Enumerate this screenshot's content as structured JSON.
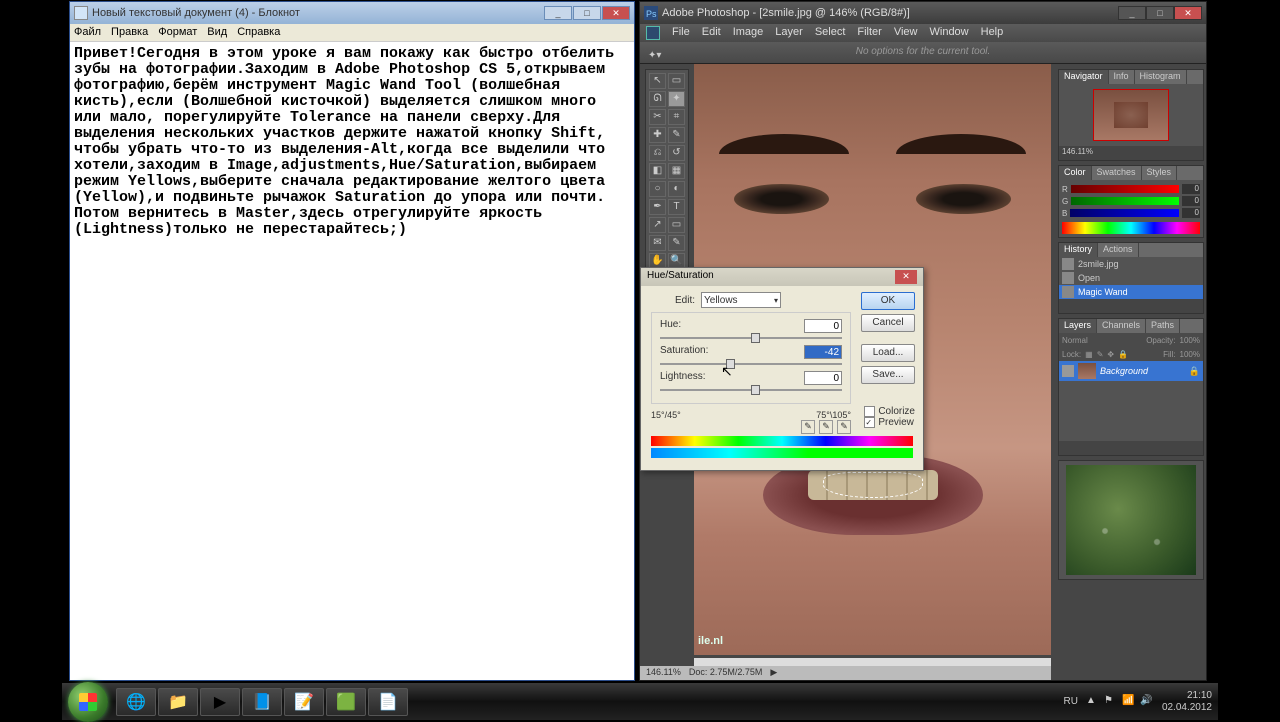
{
  "notepad": {
    "title": "Новый текстовый документ (4) - Блокнот",
    "menu": [
      "Файл",
      "Правка",
      "Формат",
      "Вид",
      "Справка"
    ],
    "content": "Привет!Сегодня в этом уроке я вам покажу как быстро отбелить зубы на фотографии.Заходим в Adobe Photoshop CS 5,открываем фотографию,берём инструмент Magic Wand Tool (волшебная кисть),если (Волшебной кисточкой) выделяется слишком много или мало, порегулируйте Tolerance на панели сверху.Для выделения нескольких участков держите нажатой кнопку Shift, чтобы убрать что-то из выделения-Alt,когда все выделили что хотели,заходим в Image,adjustments,Hue/Saturation,выбираем режим Yellows,выберите сначала редактирование желтого цвета (Yellow),и подвиньте рычажок Saturation до упора или почти. Потом вернитесь в Master,здесь отрегулируйте яркость (Lightness)только не перестарайтесь;)"
  },
  "photoshop": {
    "title": "Adobe Photoshop - [2smile.jpg @ 146% (RGB/8#)]",
    "menu": [
      "File",
      "Edit",
      "Image",
      "Layer",
      "Select",
      "Filter",
      "View",
      "Window",
      "Help"
    ],
    "options_text": "No options for the current tool.",
    "watermark": "ile.nl",
    "status": {
      "zoom": "146.11%",
      "doc": "Doc: 2.75M/2.75M"
    },
    "navigator": {
      "tabs": [
        "Navigator",
        "Info",
        "Histogram"
      ],
      "zoom": "146.11%"
    },
    "color": {
      "tabs": [
        "Color",
        "Swatches",
        "Styles"
      ],
      "r": "0",
      "g": "0",
      "b": "0"
    },
    "history": {
      "tabs": [
        "History",
        "Actions"
      ],
      "file": "2smile.jpg",
      "items": [
        "Open",
        "Magic Wand"
      ]
    },
    "layers": {
      "tabs": [
        "Layers",
        "Channels",
        "Paths"
      ],
      "mode": "Normal",
      "opacity_label": "Opacity:",
      "opacity": "100%",
      "lock": "Lock:",
      "fill_label": "Fill:",
      "fill": "100%",
      "layer": "Background"
    }
  },
  "hs": {
    "title": "Hue/Saturation",
    "edit_label": "Edit:",
    "edit_value": "Yellows",
    "hue_label": "Hue:",
    "hue_value": "0",
    "sat_label": "Saturation:",
    "sat_value": "-42",
    "light_label": "Lightness:",
    "light_value": "0",
    "range_left": "15°/45°",
    "range_right": "75°\\105°",
    "ok": "OK",
    "cancel": "Cancel",
    "load": "Load...",
    "save": "Save...",
    "colorize": "Colorize",
    "preview": "Preview"
  },
  "taskbar": {
    "lang": "RU",
    "time": "21:10",
    "date": "02.04.2012"
  }
}
